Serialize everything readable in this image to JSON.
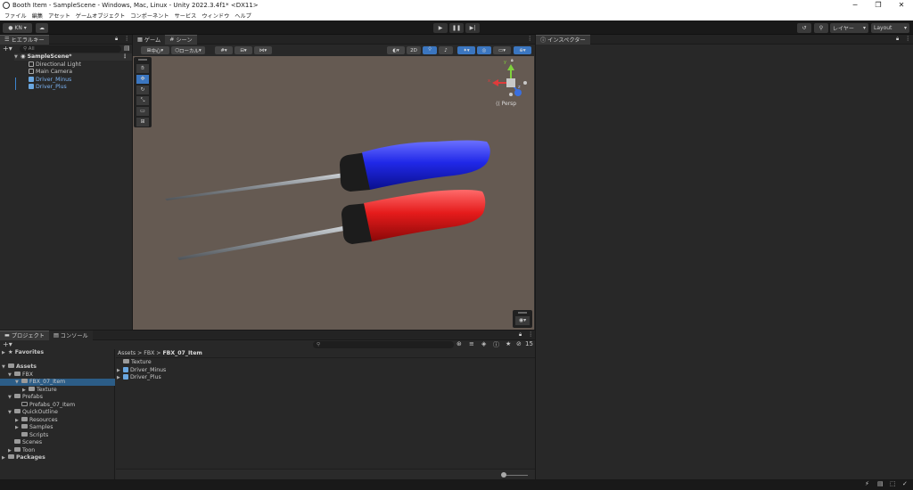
{
  "window": {
    "title": "Booth Item - SampleScene - Windows, Mac, Linux - Unity 2022.3.4f1* <DX11>",
    "controls": [
      "─",
      "❐",
      "✕"
    ]
  },
  "menu": [
    "ファイル",
    "編集",
    "アセット",
    "ゲームオブジェクト",
    "コンポーネント",
    "サービス",
    "ウィンドウ",
    "ヘルプ"
  ],
  "toolbar": {
    "account": "KN",
    "layers": "レイヤー",
    "layout": "Layout"
  },
  "hierarchy": {
    "tab": "ヒエラルキー",
    "search_placeholder": "All",
    "scene": "SampleScene*",
    "items": [
      "Directional Light",
      "Main Camera",
      "Driver_Minus",
      "Driver_Plus"
    ]
  },
  "scene_tabs": {
    "game": "ゲーム",
    "scene": "シーン"
  },
  "scene_toolbar": {
    "pivot": "中心",
    "space": "ローカル",
    "mode2d": "2D"
  },
  "scene_view": {
    "persp": "Persp",
    "axis_y": "y",
    "axis_x": "x",
    "axis_z": "z"
  },
  "inspector": {
    "tab": "インスペクター"
  },
  "project": {
    "tab_project": "プロジェクト",
    "tab_console": "コンソール",
    "hidden_count": "15",
    "tree": [
      "Favorites",
      "Assets",
      "FBX",
      "FBX_07_Item",
      "Texture",
      "Prefabs",
      "Prefabs_07_Item",
      "QuickOutline",
      "Resources",
      "Samples",
      "Scripts",
      "Scenes",
      "Toon",
      "Packages"
    ],
    "breadcrumb": [
      "Assets",
      "FBX",
      "FBX_07_Item"
    ],
    "files": [
      "Texture",
      "Driver_Minus",
      "Driver_Plus"
    ]
  },
  "colors": {
    "selected": "#2c5d87",
    "accent": "#3b76c0",
    "scene_bg": "#655a52",
    "handle_blue": "#1f26e6",
    "handle_red": "#e01b1b"
  }
}
